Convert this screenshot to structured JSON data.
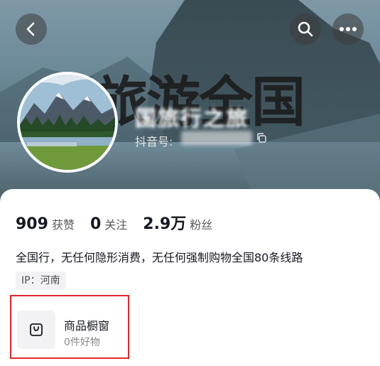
{
  "header": {
    "banner_text": "国旅游全国",
    "back_icon": "chevron-left-icon",
    "search_icon": "search-icon",
    "more_icon": "more-icon"
  },
  "profile": {
    "username": "国旅行之旅",
    "douyin_label": "抖音号:",
    "douyin_id": "",
    "avatar": "mountain-lake-landscape"
  },
  "stats": [
    {
      "value": "909",
      "label": "获赞"
    },
    {
      "value": "0",
      "label": "关注"
    },
    {
      "value": "2.9万",
      "label": "粉丝"
    }
  ],
  "bio": "全国行，无任何隐形消费，无任何强制购物全国80条线路",
  "ip_tag": "IP：河南",
  "shop": {
    "title": "商品橱窗",
    "subtitle": "0件好物",
    "icon": "shopping-bag-icon"
  },
  "colors": {
    "highlight_border": "#e3262b",
    "text_primary": "#161823"
  }
}
